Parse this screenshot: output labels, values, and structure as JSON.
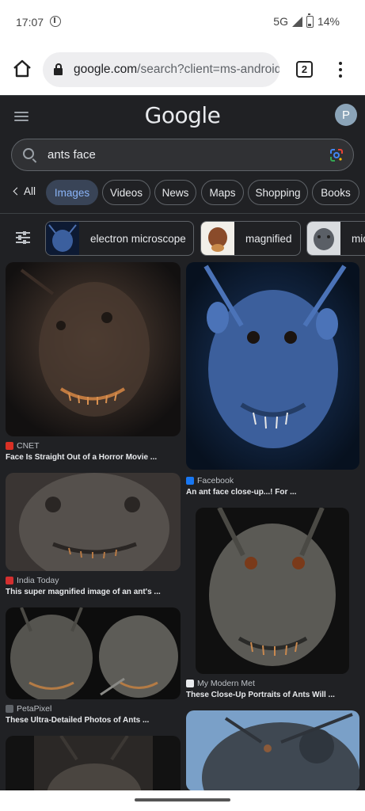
{
  "status": {
    "time": "17:07",
    "network": "5G",
    "battery": "14%"
  },
  "browser": {
    "url_host": "google.com",
    "url_path": "/search?client=ms-android",
    "tab_count": "2"
  },
  "google": {
    "logo": "Google",
    "avatar_initial": "P",
    "query": "ants face"
  },
  "filters": {
    "all": "All",
    "chips": [
      "Images",
      "Videos",
      "News",
      "Maps",
      "Shopping",
      "Books"
    ]
  },
  "refinements": [
    "electron microscope",
    "magnified",
    "mic"
  ],
  "results": [
    {
      "source": "CNET",
      "caption": "Face Is Straight Out of a Horror Movie ..."
    },
    {
      "source": "Facebook",
      "caption": "An ant face close-up...! For ..."
    },
    {
      "source": "India Today",
      "caption": "This super magnified image of an ant's ..."
    },
    {
      "source": "My Modern Met",
      "caption": "These Close-Up Portraits of Ants Will ..."
    },
    {
      "source": "PetaPixel",
      "caption": "These Ultra-Detailed Photos of Ants ..."
    }
  ],
  "colors": {
    "page_bg": "#202124",
    "active_chip": "#394457",
    "active_text": "#8ab4f8"
  }
}
